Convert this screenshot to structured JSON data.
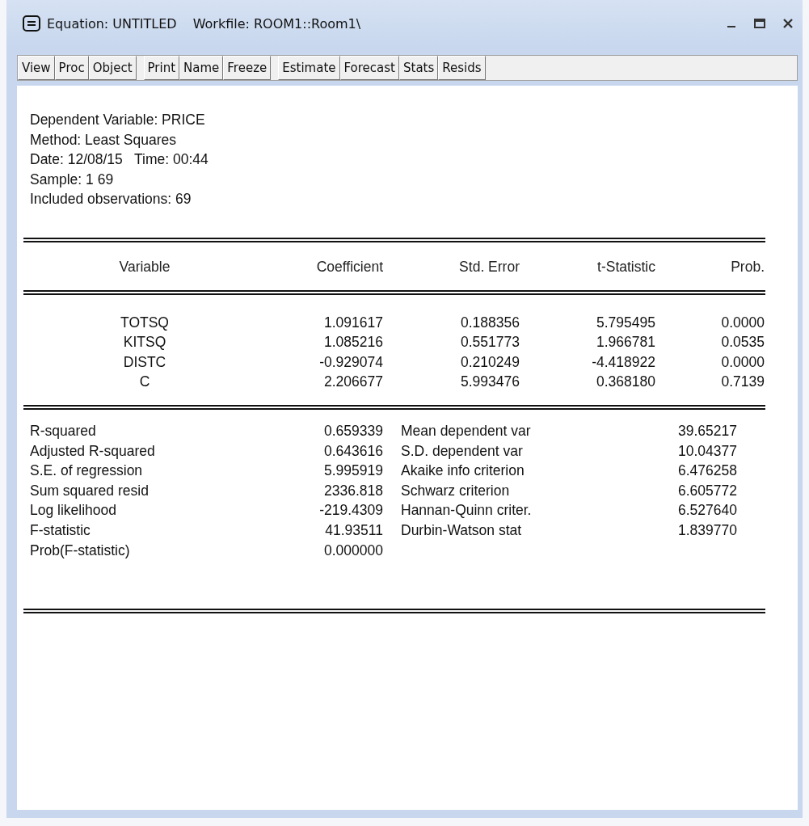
{
  "window": {
    "title": "Equation: UNTITLED",
    "workfile": "Workfile: ROOM1::Room1\\"
  },
  "toolbar": [
    [
      "View",
      "Proc",
      "Object"
    ],
    [
      "Print",
      "Name",
      "Freeze"
    ],
    [
      "Estimate",
      "Forecast",
      "Stats",
      "Resids"
    ]
  ],
  "header": [
    "Dependent Variable: PRICE",
    "Method: Least Squares",
    "Date: 12/08/15   Time: 00:44",
    "Sample: 1 69",
    "Included observations: 69"
  ],
  "coefficients": {
    "columns": [
      "Variable",
      "Coefficient",
      "Std. Error",
      "t-Statistic",
      "Prob."
    ],
    "rows": [
      [
        "TOTSQ",
        "1.091617",
        "0.188356",
        "5.795495",
        "0.0000"
      ],
      [
        "KITSQ",
        "1.085216",
        "0.551773",
        "1.966781",
        "0.0535"
      ],
      [
        "DISTC",
        "-0.929074",
        "0.210249",
        "-4.418922",
        "0.0000"
      ],
      [
        "C",
        "2.206677",
        "5.993476",
        "0.368180",
        "0.7139"
      ]
    ]
  },
  "statistics": [
    [
      "R-squared",
      "0.659339",
      "Mean dependent var",
      "39.65217"
    ],
    [
      "Adjusted R-squared",
      "0.643616",
      "S.D. dependent var",
      "10.04377"
    ],
    [
      "S.E. of regression",
      "5.995919",
      "Akaike info criterion",
      "6.476258"
    ],
    [
      "Sum squared resid",
      "2336.818",
      "Schwarz criterion",
      "6.605772"
    ],
    [
      "Log likelihood",
      "-219.4309",
      "Hannan-Quinn criter.",
      "6.527640"
    ],
    [
      "F-statistic",
      "41.93511",
      "Durbin-Watson stat",
      "1.839770"
    ],
    [
      "Prob(F-statistic)",
      "0.000000"
    ]
  ]
}
